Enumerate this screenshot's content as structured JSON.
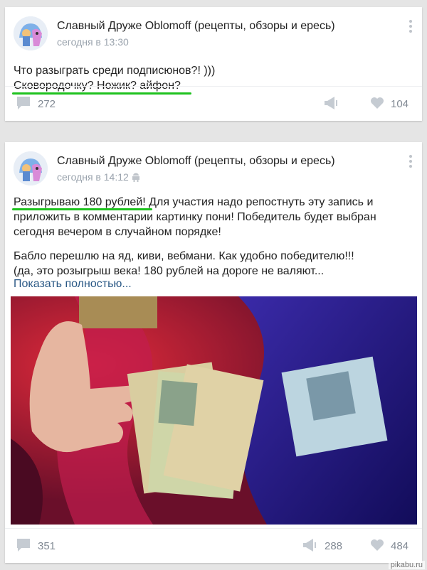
{
  "posts": [
    {
      "author": "Славный Друже Oblomoff (рецепты, обзоры и ересь)",
      "time": "сегодня в 13:30",
      "text_lines": [
        "Что разыграть среди подписюнов?! )))",
        "Сковородочку? Ножик? айфон?"
      ],
      "comments": "272",
      "likes": "104"
    },
    {
      "author": "Славный Друже Oblomoff (рецепты, обзоры и ересь)",
      "time": "сегодня в 14:12",
      "highlight": "Разыгрываю 180 рублей",
      "line1_rest": "! Для участия надо репостнуть эту запись и",
      "text_lines": [
        "приложить в комментарии картинку пони! Победитель будет выбран",
        "сегодня вечером в случайном порядке!",
        "Бабло перешлю на яд, киви, вебмани. Как удобно победителю!!!",
        "(да, это розыгрыш века! 180 рублей на дороге не валяют..."
      ],
      "show_more": "Показать полностью...",
      "comments": "351",
      "reposts": "288",
      "likes": "484"
    }
  ],
  "watermark": "pikabu.ru",
  "colors": {
    "underline": "#1ec21e",
    "link": "#2a5885",
    "meta": "#9aa3ad",
    "footer_icon": "#c5cbd2"
  }
}
